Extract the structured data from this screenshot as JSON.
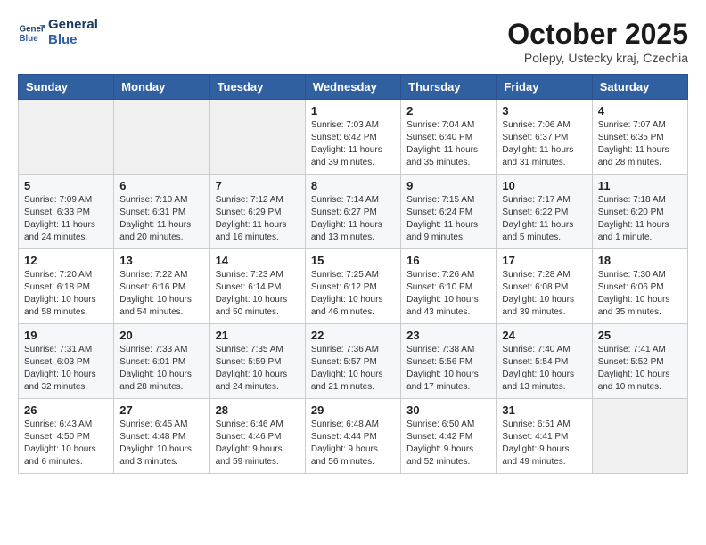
{
  "logo": {
    "line1": "General",
    "line2": "Blue"
  },
  "title": "October 2025",
  "location": "Polepy, Ustecky kraj, Czechia",
  "weekdays": [
    "Sunday",
    "Monday",
    "Tuesday",
    "Wednesday",
    "Thursday",
    "Friday",
    "Saturday"
  ],
  "weeks": [
    [
      {
        "day": "",
        "info": ""
      },
      {
        "day": "",
        "info": ""
      },
      {
        "day": "",
        "info": ""
      },
      {
        "day": "1",
        "info": "Sunrise: 7:03 AM\nSunset: 6:42 PM\nDaylight: 11 hours\nand 39 minutes."
      },
      {
        "day": "2",
        "info": "Sunrise: 7:04 AM\nSunset: 6:40 PM\nDaylight: 11 hours\nand 35 minutes."
      },
      {
        "day": "3",
        "info": "Sunrise: 7:06 AM\nSunset: 6:37 PM\nDaylight: 11 hours\nand 31 minutes."
      },
      {
        "day": "4",
        "info": "Sunrise: 7:07 AM\nSunset: 6:35 PM\nDaylight: 11 hours\nand 28 minutes."
      }
    ],
    [
      {
        "day": "5",
        "info": "Sunrise: 7:09 AM\nSunset: 6:33 PM\nDaylight: 11 hours\nand 24 minutes."
      },
      {
        "day": "6",
        "info": "Sunrise: 7:10 AM\nSunset: 6:31 PM\nDaylight: 11 hours\nand 20 minutes."
      },
      {
        "day": "7",
        "info": "Sunrise: 7:12 AM\nSunset: 6:29 PM\nDaylight: 11 hours\nand 16 minutes."
      },
      {
        "day": "8",
        "info": "Sunrise: 7:14 AM\nSunset: 6:27 PM\nDaylight: 11 hours\nand 13 minutes."
      },
      {
        "day": "9",
        "info": "Sunrise: 7:15 AM\nSunset: 6:24 PM\nDaylight: 11 hours\nand 9 minutes."
      },
      {
        "day": "10",
        "info": "Sunrise: 7:17 AM\nSunset: 6:22 PM\nDaylight: 11 hours\nand 5 minutes."
      },
      {
        "day": "11",
        "info": "Sunrise: 7:18 AM\nSunset: 6:20 PM\nDaylight: 11 hours\nand 1 minute."
      }
    ],
    [
      {
        "day": "12",
        "info": "Sunrise: 7:20 AM\nSunset: 6:18 PM\nDaylight: 10 hours\nand 58 minutes."
      },
      {
        "day": "13",
        "info": "Sunrise: 7:22 AM\nSunset: 6:16 PM\nDaylight: 10 hours\nand 54 minutes."
      },
      {
        "day": "14",
        "info": "Sunrise: 7:23 AM\nSunset: 6:14 PM\nDaylight: 10 hours\nand 50 minutes."
      },
      {
        "day": "15",
        "info": "Sunrise: 7:25 AM\nSunset: 6:12 PM\nDaylight: 10 hours\nand 46 minutes."
      },
      {
        "day": "16",
        "info": "Sunrise: 7:26 AM\nSunset: 6:10 PM\nDaylight: 10 hours\nand 43 minutes."
      },
      {
        "day": "17",
        "info": "Sunrise: 7:28 AM\nSunset: 6:08 PM\nDaylight: 10 hours\nand 39 minutes."
      },
      {
        "day": "18",
        "info": "Sunrise: 7:30 AM\nSunset: 6:06 PM\nDaylight: 10 hours\nand 35 minutes."
      }
    ],
    [
      {
        "day": "19",
        "info": "Sunrise: 7:31 AM\nSunset: 6:03 PM\nDaylight: 10 hours\nand 32 minutes."
      },
      {
        "day": "20",
        "info": "Sunrise: 7:33 AM\nSunset: 6:01 PM\nDaylight: 10 hours\nand 28 minutes."
      },
      {
        "day": "21",
        "info": "Sunrise: 7:35 AM\nSunset: 5:59 PM\nDaylight: 10 hours\nand 24 minutes."
      },
      {
        "day": "22",
        "info": "Sunrise: 7:36 AM\nSunset: 5:57 PM\nDaylight: 10 hours\nand 21 minutes."
      },
      {
        "day": "23",
        "info": "Sunrise: 7:38 AM\nSunset: 5:56 PM\nDaylight: 10 hours\nand 17 minutes."
      },
      {
        "day": "24",
        "info": "Sunrise: 7:40 AM\nSunset: 5:54 PM\nDaylight: 10 hours\nand 13 minutes."
      },
      {
        "day": "25",
        "info": "Sunrise: 7:41 AM\nSunset: 5:52 PM\nDaylight: 10 hours\nand 10 minutes."
      }
    ],
    [
      {
        "day": "26",
        "info": "Sunrise: 6:43 AM\nSunset: 4:50 PM\nDaylight: 10 hours\nand 6 minutes."
      },
      {
        "day": "27",
        "info": "Sunrise: 6:45 AM\nSunset: 4:48 PM\nDaylight: 10 hours\nand 3 minutes."
      },
      {
        "day": "28",
        "info": "Sunrise: 6:46 AM\nSunset: 4:46 PM\nDaylight: 9 hours\nand 59 minutes."
      },
      {
        "day": "29",
        "info": "Sunrise: 6:48 AM\nSunset: 4:44 PM\nDaylight: 9 hours\nand 56 minutes."
      },
      {
        "day": "30",
        "info": "Sunrise: 6:50 AM\nSunset: 4:42 PM\nDaylight: 9 hours\nand 52 minutes."
      },
      {
        "day": "31",
        "info": "Sunrise: 6:51 AM\nSunset: 4:41 PM\nDaylight: 9 hours\nand 49 minutes."
      },
      {
        "day": "",
        "info": ""
      }
    ]
  ]
}
